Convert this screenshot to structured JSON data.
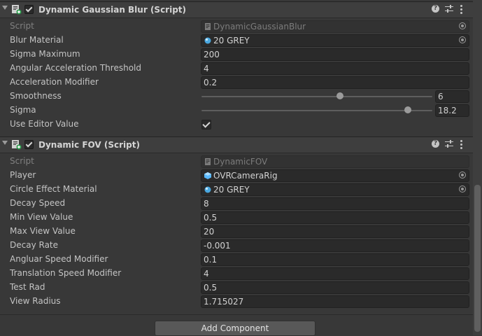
{
  "components": [
    {
      "title": "Dynamic Gaussian Blur (Script)",
      "enabled": true,
      "fields": [
        {
          "label": "Script",
          "value": "DynamicGaussianBlur",
          "kind": "script"
        },
        {
          "label": "Blur Material",
          "value": "20 GREY",
          "kind": "object",
          "icon": "material-icon"
        },
        {
          "label": "Sigma Maximum",
          "value": "200",
          "kind": "text"
        },
        {
          "label": "Angular Acceleration Threshold",
          "value": "4",
          "kind": "text"
        },
        {
          "label": "Acceleration Modifier",
          "value": "0.2",
          "kind": "text"
        },
        {
          "label": "Smoothness",
          "value": "6",
          "kind": "slider",
          "slider_fraction": 0.6
        },
        {
          "label": "Sigma",
          "value": "18.2",
          "kind": "slider",
          "slider_fraction": 0.895
        },
        {
          "label": "Use Editor Value",
          "value": true,
          "kind": "toggle"
        }
      ]
    },
    {
      "title": "Dynamic FOV (Script)",
      "enabled": true,
      "fields": [
        {
          "label": "Script",
          "value": "DynamicFOV",
          "kind": "script"
        },
        {
          "label": "Player",
          "value": "OVRCameraRig",
          "kind": "object",
          "icon": "prefab-icon"
        },
        {
          "label": "Circle Effect Material",
          "value": "20 GREY",
          "kind": "object",
          "icon": "material-icon"
        },
        {
          "label": "Decay Speed",
          "value": "8",
          "kind": "text"
        },
        {
          "label": "Min View Value",
          "value": "0.5",
          "kind": "text"
        },
        {
          "label": "Max View Value",
          "value": "20",
          "kind": "text"
        },
        {
          "label": "Decay Rate",
          "value": "-0.001",
          "kind": "text"
        },
        {
          "label": "Angluar Speed Modifier",
          "value": "0.1",
          "kind": "text"
        },
        {
          "label": "Translation Speed Modifier",
          "value": "4",
          "kind": "text"
        },
        {
          "label": "Test Rad",
          "value": "0.5",
          "kind": "text"
        },
        {
          "label": "View Radius",
          "value": "1.715027",
          "kind": "text"
        }
      ]
    }
  ],
  "header_icons": {
    "help": "?",
    "help_icon": "help-icon",
    "preset_icon": "preset-icon",
    "menu_icon": "kebab-menu-icon"
  },
  "add_component_label": "Add Component",
  "colors": {
    "panel": "#383838",
    "header": "#3e3e3e",
    "field": "#2a2a2a",
    "material": "#4aa8e0",
    "prefab": "#58b8ff"
  }
}
